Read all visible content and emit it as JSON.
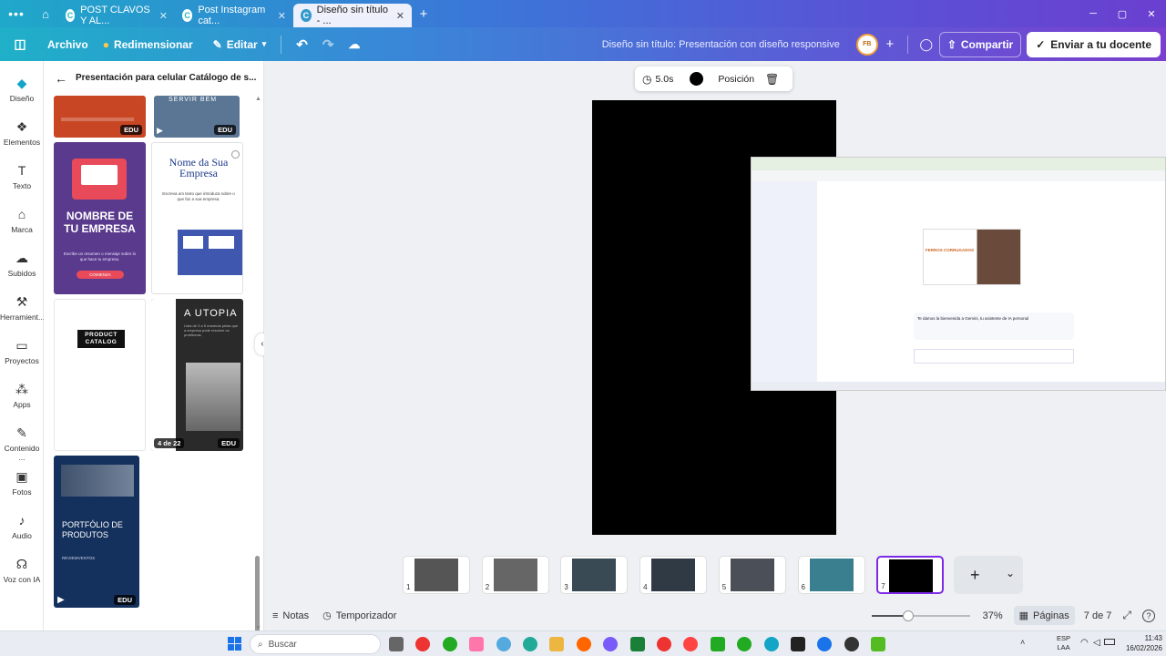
{
  "browser": {
    "menu_icon": "dots-icon",
    "tabs": [
      {
        "label": "POST CLAVOS Y AL...",
        "active": false
      },
      {
        "label": "Post Instagram cat...",
        "active": false
      },
      {
        "label": "Diseño sin título - ...",
        "active": true
      }
    ],
    "new_tab": "+",
    "window_controls": [
      "─",
      "▢",
      "✕"
    ]
  },
  "toolbar": {
    "file": "Archivo",
    "resize": "Redimensionar",
    "edit": "Editar",
    "title": "Diseño sin título: Presentación con diseño responsive",
    "share": "Compartir",
    "send": "Enviar a tu docente",
    "avatar_initials": "FB",
    "add": "+"
  },
  "rail": [
    {
      "label": "Diseño",
      "icon": "design-icon"
    },
    {
      "label": "Elementos",
      "icon": "elements-icon"
    },
    {
      "label": "Texto",
      "icon": "text-icon"
    },
    {
      "label": "Marca",
      "icon": "brand-icon"
    },
    {
      "label": "Subidos",
      "icon": "upload-icon"
    },
    {
      "label": "Herramient...",
      "icon": "tools-icon"
    },
    {
      "label": "Proyectos",
      "icon": "folder-icon"
    },
    {
      "label": "Apps",
      "icon": "apps-icon"
    },
    {
      "label": "Contenido ...",
      "icon": "content-icon"
    },
    {
      "label": "Fotos",
      "icon": "photo-icon"
    },
    {
      "label": "Audio",
      "icon": "audio-icon"
    },
    {
      "label": "Voz con IA",
      "icon": "voice-icon"
    }
  ],
  "panel": {
    "back": "←",
    "title": "Presentación para celular Catálogo de s...",
    "edu": "EDU",
    "templates": {
      "t2_title": "SERVIR BEM",
      "t3_title": "NOMBRE DE TU EMPRESA",
      "t3_body": "Escribe un resumen o mensaje sobre lo que hace tu empresa.",
      "t3_button": "COMIENZA",
      "t4_title": "Nome da Sua Empresa",
      "t4_body": "Escreva um texto que introduza sobre o que faz a sua empresa.",
      "t5_title": "PRODUCT CATALOG",
      "t6_title": "A UTOPIA",
      "t6_body": "Lista de 3 a 5 maneras pelas que a empresa pode resolver os problemas.",
      "t6_counter": "4 de 22",
      "t7_title": "PORTFÓLIO DE PRODUTOS",
      "t7_sub": "REVIEWVENTOS"
    }
  },
  "canvas_toolbar": {
    "duration": "5.0s",
    "position": "Posición"
  },
  "screenshot": {
    "welcome": "Te damos la bienvenida a Gemini, tu asistente de IA personal",
    "promo": "FERROS CORRUGADOS"
  },
  "pages": {
    "labels": [
      "1",
      "2",
      "3",
      "4",
      "5",
      "6",
      "7"
    ],
    "active": 7,
    "add": "+"
  },
  "footer": {
    "notes": "Notas",
    "timer": "Temporizador",
    "zoom": "37%",
    "zoom_level": 0.37,
    "pages": "Páginas",
    "page_count": "7 de 7"
  },
  "taskbar": {
    "search": "Buscar",
    "lang": "ESP",
    "lang2": "LAA",
    "time": "11:43",
    "date": "16/02/2026"
  },
  "colors": {
    "accent": "#7d2ae8",
    "black_slide": "#000000"
  }
}
